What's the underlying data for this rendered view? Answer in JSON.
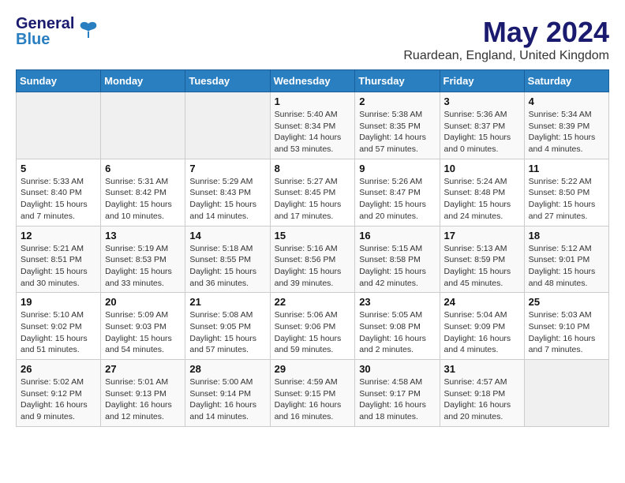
{
  "logo": {
    "line1": "General",
    "line2": "Blue"
  },
  "title": "May 2024",
  "location": "Ruardean, England, United Kingdom",
  "weekdays": [
    "Sunday",
    "Monday",
    "Tuesday",
    "Wednesday",
    "Thursday",
    "Friday",
    "Saturday"
  ],
  "weeks": [
    [
      {
        "day": "",
        "info": ""
      },
      {
        "day": "",
        "info": ""
      },
      {
        "day": "",
        "info": ""
      },
      {
        "day": "1",
        "info": "Sunrise: 5:40 AM\nSunset: 8:34 PM\nDaylight: 14 hours and 53 minutes."
      },
      {
        "day": "2",
        "info": "Sunrise: 5:38 AM\nSunset: 8:35 PM\nDaylight: 14 hours and 57 minutes."
      },
      {
        "day": "3",
        "info": "Sunrise: 5:36 AM\nSunset: 8:37 PM\nDaylight: 15 hours and 0 minutes."
      },
      {
        "day": "4",
        "info": "Sunrise: 5:34 AM\nSunset: 8:39 PM\nDaylight: 15 hours and 4 minutes."
      }
    ],
    [
      {
        "day": "5",
        "info": "Sunrise: 5:33 AM\nSunset: 8:40 PM\nDaylight: 15 hours and 7 minutes."
      },
      {
        "day": "6",
        "info": "Sunrise: 5:31 AM\nSunset: 8:42 PM\nDaylight: 15 hours and 10 minutes."
      },
      {
        "day": "7",
        "info": "Sunrise: 5:29 AM\nSunset: 8:43 PM\nDaylight: 15 hours and 14 minutes."
      },
      {
        "day": "8",
        "info": "Sunrise: 5:27 AM\nSunset: 8:45 PM\nDaylight: 15 hours and 17 minutes."
      },
      {
        "day": "9",
        "info": "Sunrise: 5:26 AM\nSunset: 8:47 PM\nDaylight: 15 hours and 20 minutes."
      },
      {
        "day": "10",
        "info": "Sunrise: 5:24 AM\nSunset: 8:48 PM\nDaylight: 15 hours and 24 minutes."
      },
      {
        "day": "11",
        "info": "Sunrise: 5:22 AM\nSunset: 8:50 PM\nDaylight: 15 hours and 27 minutes."
      }
    ],
    [
      {
        "day": "12",
        "info": "Sunrise: 5:21 AM\nSunset: 8:51 PM\nDaylight: 15 hours and 30 minutes."
      },
      {
        "day": "13",
        "info": "Sunrise: 5:19 AM\nSunset: 8:53 PM\nDaylight: 15 hours and 33 minutes."
      },
      {
        "day": "14",
        "info": "Sunrise: 5:18 AM\nSunset: 8:55 PM\nDaylight: 15 hours and 36 minutes."
      },
      {
        "day": "15",
        "info": "Sunrise: 5:16 AM\nSunset: 8:56 PM\nDaylight: 15 hours and 39 minutes."
      },
      {
        "day": "16",
        "info": "Sunrise: 5:15 AM\nSunset: 8:58 PM\nDaylight: 15 hours and 42 minutes."
      },
      {
        "day": "17",
        "info": "Sunrise: 5:13 AM\nSunset: 8:59 PM\nDaylight: 15 hours and 45 minutes."
      },
      {
        "day": "18",
        "info": "Sunrise: 5:12 AM\nSunset: 9:01 PM\nDaylight: 15 hours and 48 minutes."
      }
    ],
    [
      {
        "day": "19",
        "info": "Sunrise: 5:10 AM\nSunset: 9:02 PM\nDaylight: 15 hours and 51 minutes."
      },
      {
        "day": "20",
        "info": "Sunrise: 5:09 AM\nSunset: 9:03 PM\nDaylight: 15 hours and 54 minutes."
      },
      {
        "day": "21",
        "info": "Sunrise: 5:08 AM\nSunset: 9:05 PM\nDaylight: 15 hours and 57 minutes."
      },
      {
        "day": "22",
        "info": "Sunrise: 5:06 AM\nSunset: 9:06 PM\nDaylight: 15 hours and 59 minutes."
      },
      {
        "day": "23",
        "info": "Sunrise: 5:05 AM\nSunset: 9:08 PM\nDaylight: 16 hours and 2 minutes."
      },
      {
        "day": "24",
        "info": "Sunrise: 5:04 AM\nSunset: 9:09 PM\nDaylight: 16 hours and 4 minutes."
      },
      {
        "day": "25",
        "info": "Sunrise: 5:03 AM\nSunset: 9:10 PM\nDaylight: 16 hours and 7 minutes."
      }
    ],
    [
      {
        "day": "26",
        "info": "Sunrise: 5:02 AM\nSunset: 9:12 PM\nDaylight: 16 hours and 9 minutes."
      },
      {
        "day": "27",
        "info": "Sunrise: 5:01 AM\nSunset: 9:13 PM\nDaylight: 16 hours and 12 minutes."
      },
      {
        "day": "28",
        "info": "Sunrise: 5:00 AM\nSunset: 9:14 PM\nDaylight: 16 hours and 14 minutes."
      },
      {
        "day": "29",
        "info": "Sunrise: 4:59 AM\nSunset: 9:15 PM\nDaylight: 16 hours and 16 minutes."
      },
      {
        "day": "30",
        "info": "Sunrise: 4:58 AM\nSunset: 9:17 PM\nDaylight: 16 hours and 18 minutes."
      },
      {
        "day": "31",
        "info": "Sunrise: 4:57 AM\nSunset: 9:18 PM\nDaylight: 16 hours and 20 minutes."
      },
      {
        "day": "",
        "info": ""
      }
    ]
  ]
}
